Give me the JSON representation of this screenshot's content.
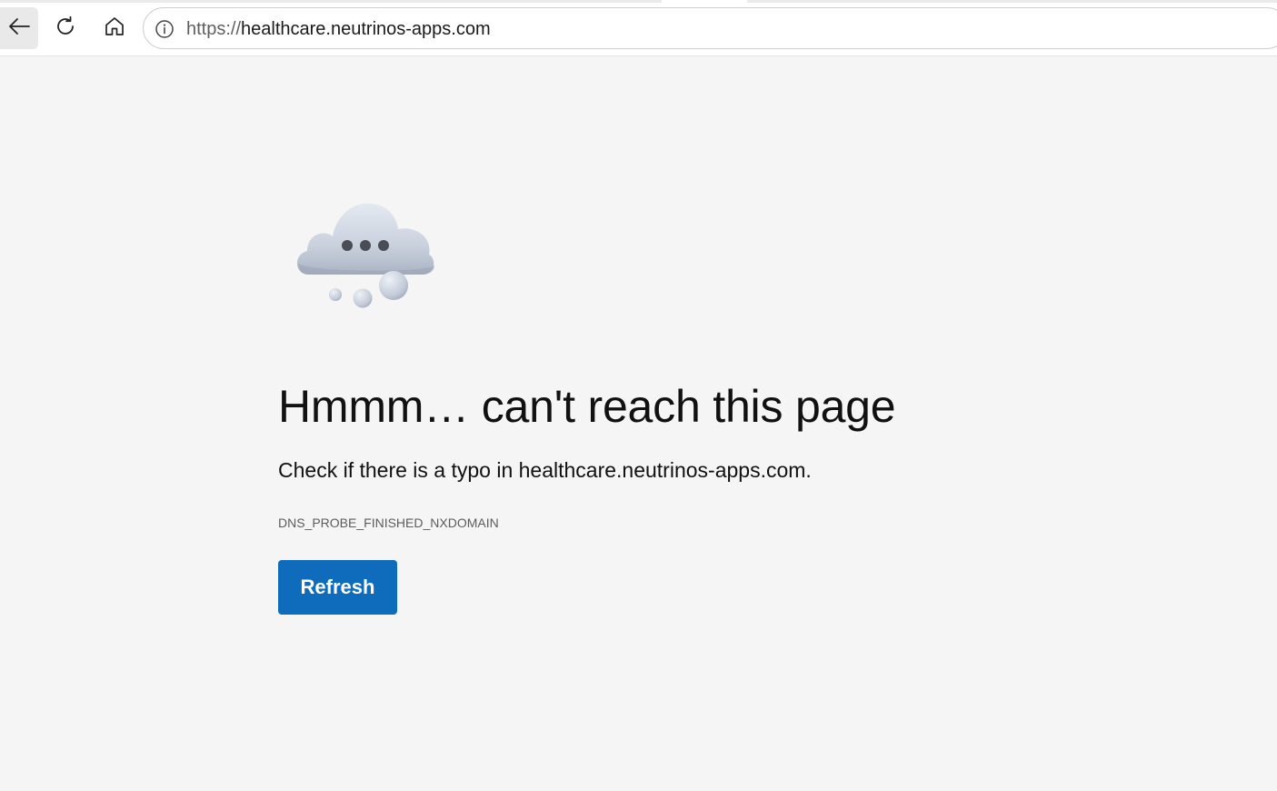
{
  "browser": {
    "url_scheme": "https://",
    "url_host": "healthcare.neutrinos-apps.com",
    "icons": {
      "back": "back-arrow-icon",
      "reload": "reload-icon",
      "home": "home-icon",
      "site_info": "info-icon"
    }
  },
  "error_page": {
    "illustration": "cloud-thinking-icon",
    "headline": "Hmmm… can't reach this page",
    "subline": "Check if there is a typo in healthcare.neutrinos-apps.com.",
    "error_code": "DNS_PROBE_FINISHED_NXDOMAIN",
    "refresh_label": "Refresh"
  },
  "colors": {
    "page_background": "#f5f5f5",
    "button_accent": "#0f6cbd",
    "text_primary": "#111111",
    "text_secondary": "#5c5c5c"
  }
}
